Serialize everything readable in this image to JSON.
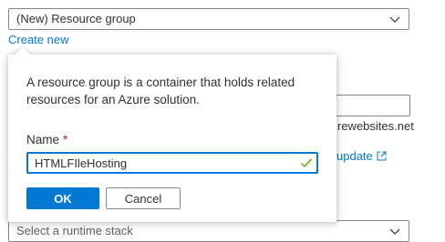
{
  "resource_group": {
    "selected_value": "(New) Resource group",
    "create_new_label": "Create new"
  },
  "background": {
    "domain_suffix": "rewebsites.net",
    "update_link": "update",
    "runtime_placeholder": "Select a runtime stack"
  },
  "callout": {
    "description": "A resource group is a container that holds related resources for an Azure solution.",
    "name_label": "Name",
    "required_marker": "*",
    "name_value": "HTMLFIleHosting",
    "ok_label": "OK",
    "cancel_label": "Cancel"
  },
  "colors": {
    "accent": "#0078d4",
    "valid": "#57a300",
    "required": "#a4262c"
  },
  "icons": {
    "dropdown": "chevron-down-icon",
    "external": "external-link-icon",
    "valid": "checkmark-icon"
  }
}
